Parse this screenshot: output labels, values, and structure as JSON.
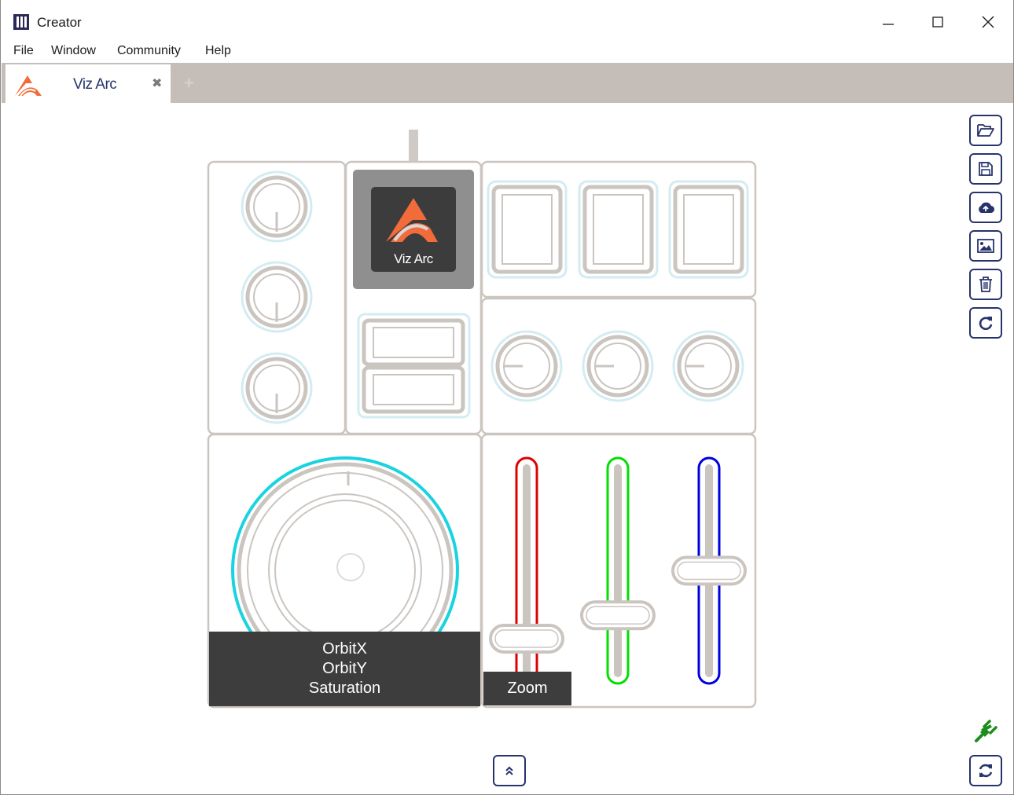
{
  "window": {
    "title": "Creator",
    "minimize_label": "–",
    "maximize_label": "☐",
    "close_label": "✕"
  },
  "menu": [
    "File",
    "Window",
    "Community",
    "Help"
  ],
  "tabs": [
    {
      "label": "Viz Arc",
      "close": "✖"
    }
  ],
  "add_tab_label": "+",
  "device": {
    "logo_button_label": "Viz Arc",
    "jog_labels": [
      "OrbitX",
      "OrbitY",
      "Saturation"
    ],
    "fader_label": "Zoom",
    "fader_colors": [
      "#e00000",
      "#00e000",
      "#0000e0"
    ],
    "fader_levels": [
      0.15,
      0.27,
      0.5
    ]
  },
  "sidebar_icons": [
    "folder-open-icon",
    "save-icon",
    "cloud-upload-icon",
    "image-icon",
    "trash-icon",
    "refresh-icon"
  ],
  "bottom_icons": [
    "double-chevron-up-icon",
    "plug-icon",
    "sync-icon"
  ],
  "colors": {
    "accent": "#27346b",
    "tabbar": "#c5bdb7",
    "control_stroke": "#c9c3be",
    "glow": "#d3ecf2",
    "jog_ring": "#19d3e0",
    "logo_orange": "#f26b3a",
    "plug_green": "#1c8c1c"
  }
}
